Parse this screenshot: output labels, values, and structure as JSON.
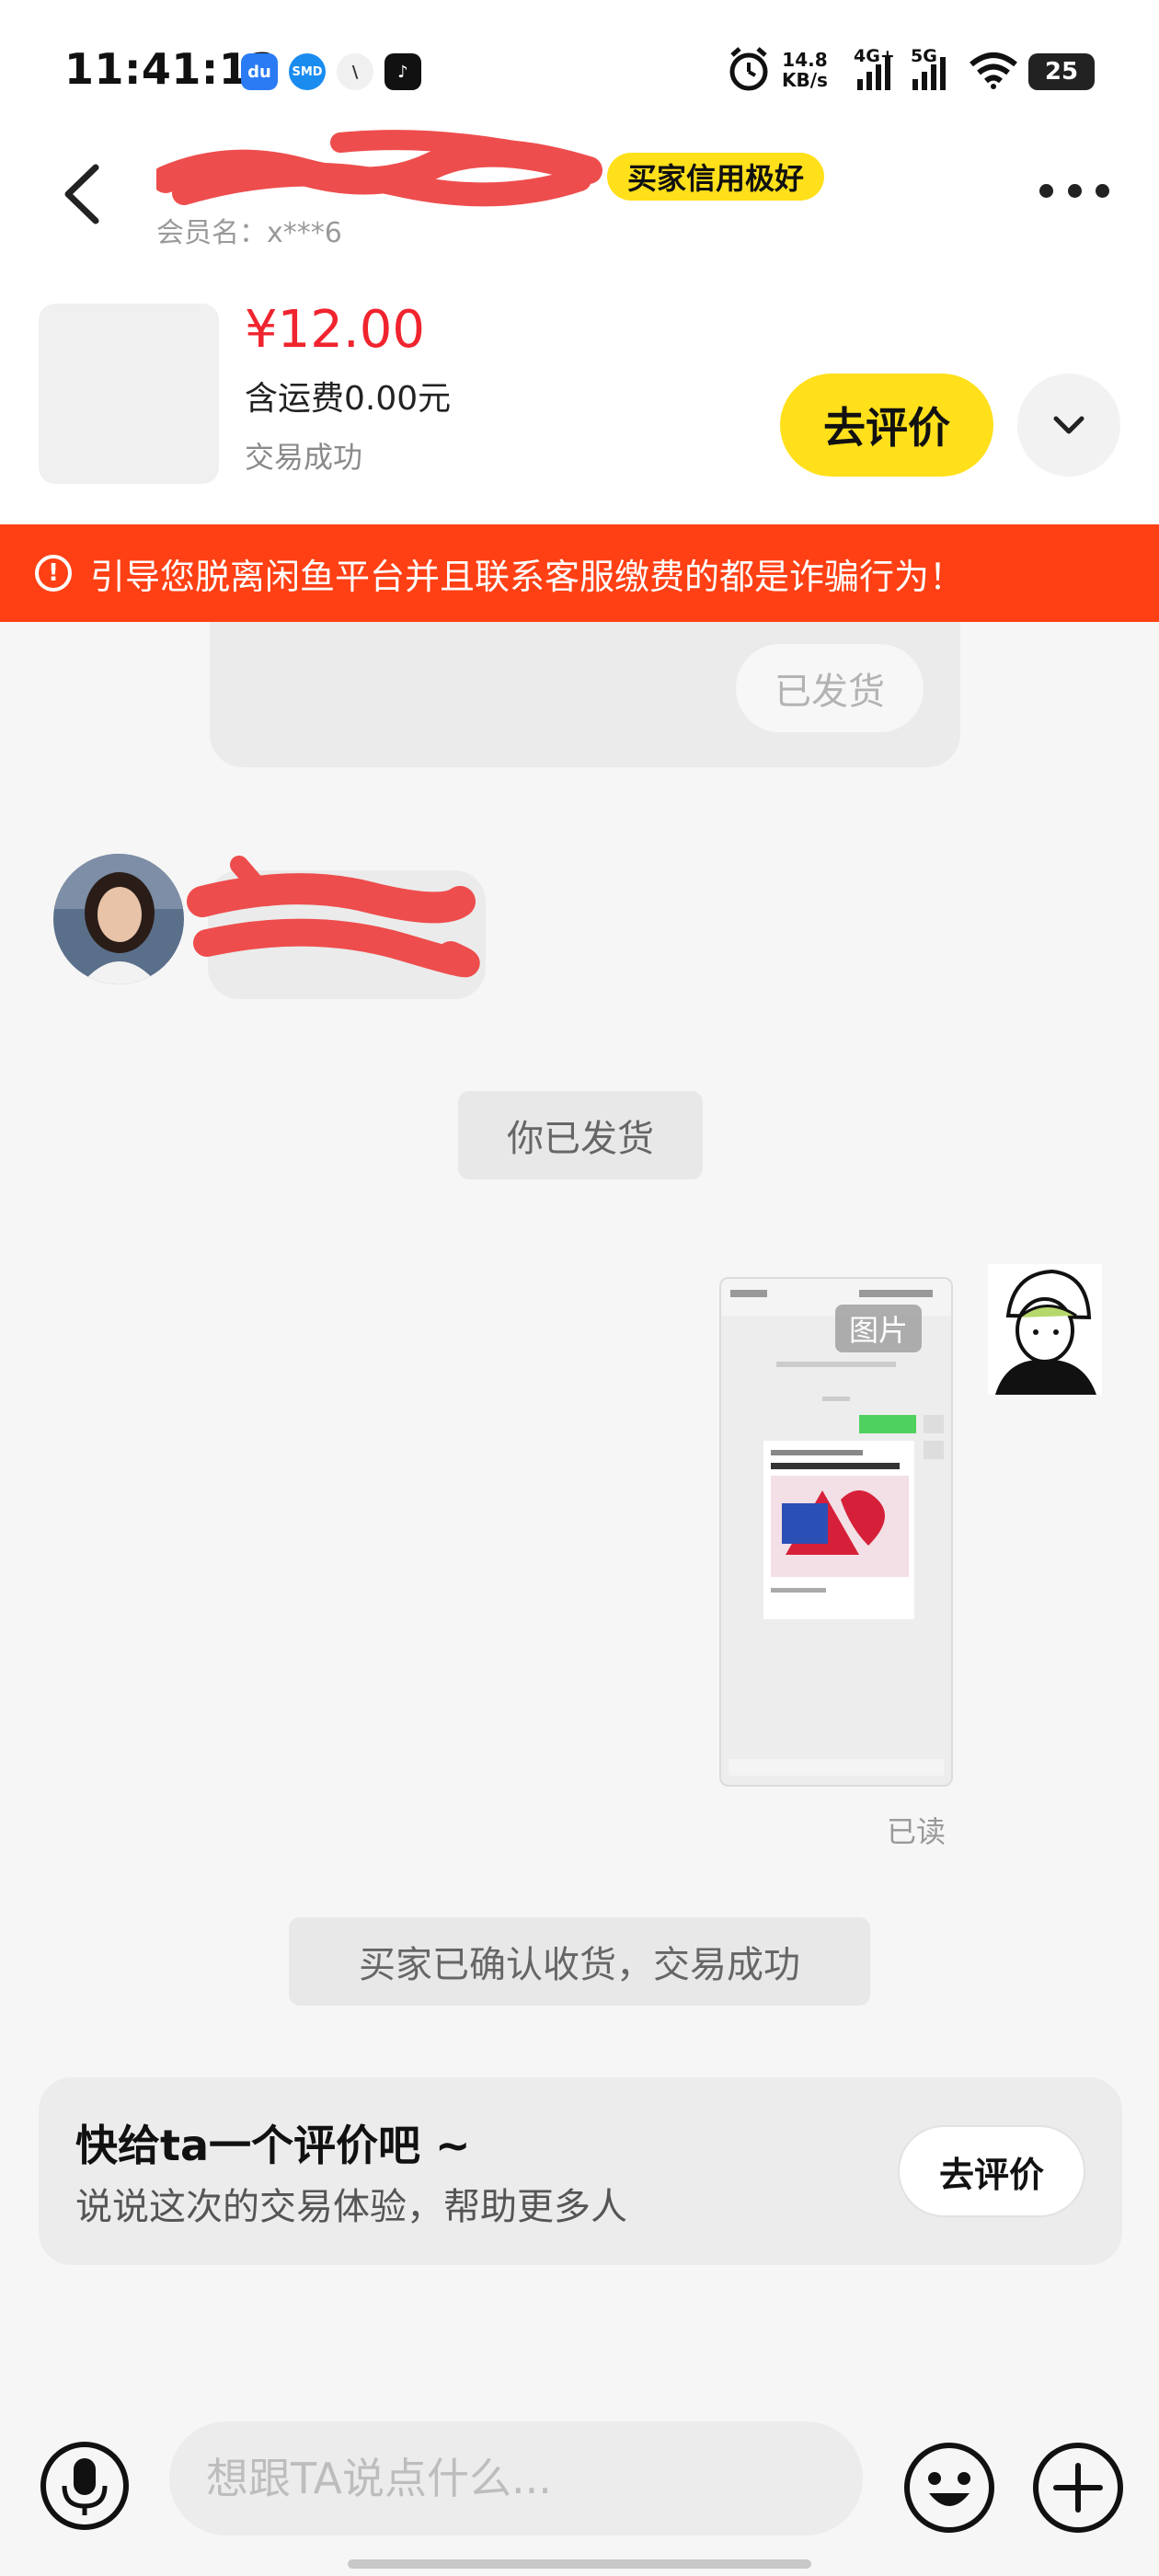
{
  "status_bar": {
    "time": "11:41:13",
    "speed_value": "14.8",
    "speed_unit": "KB/s",
    "net1": "4G+",
    "net2": "5G",
    "battery": "25",
    "app_icons": [
      "du-icon",
      "smd-icon",
      "vpn-icon",
      "tiktok-icon"
    ]
  },
  "header": {
    "credit_badge": "买家信用极好",
    "member": "会员名：x***6"
  },
  "product": {
    "price": "¥12.00",
    "shipping": "含运费0.00元",
    "status": "交易成功",
    "review_button": "去评价"
  },
  "warning": {
    "icon": "!",
    "text": "引导您脱离闲鱼平台并且联系客服缴费的都是诈骗行为！"
  },
  "chat": {
    "card_button": "已发货",
    "system_shipped": "你已发货",
    "image_tag": "图片",
    "read_status": "已读",
    "system_confirmed": "买家已确认收货，交易成功"
  },
  "rating": {
    "title": "快给ta一个评价吧 ~",
    "subtitle": "说说这次的交易体验，帮助更多人",
    "button": "去评价"
  },
  "input_bar": {
    "placeholder": "想跟TA说点什么..."
  },
  "colors": {
    "accent_yellow": "#ffe01b",
    "price_red": "#f0242e",
    "warning_orange": "#ff4014"
  }
}
